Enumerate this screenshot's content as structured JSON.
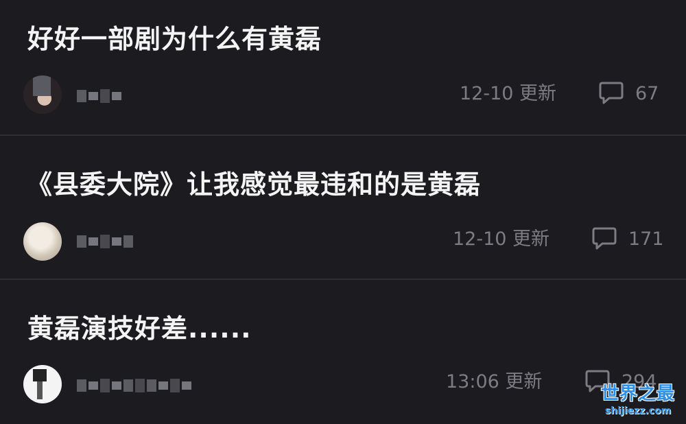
{
  "posts": [
    {
      "title": "好好一部剧为什么有黄磊",
      "time": "12-10 更新",
      "comments": "67",
      "icon": "comment-icon"
    },
    {
      "title": "《县委大院》让我感觉最违和的是黄磊",
      "time": "12-10 更新",
      "comments": "171",
      "icon": "comment-icon"
    },
    {
      "title": "黄磊演技好差......",
      "time": "13:06 更新",
      "comments": "294",
      "icon": "comment-icon"
    }
  ],
  "watermark": {
    "title": "世界之最",
    "url": "shijiezz.com"
  },
  "colors": {
    "background": "#1c1c20",
    "title_text": "#f4f4f4",
    "meta_text": "#7c7c82",
    "divider": "#2e2e33",
    "watermark": "#2e8fe8"
  }
}
